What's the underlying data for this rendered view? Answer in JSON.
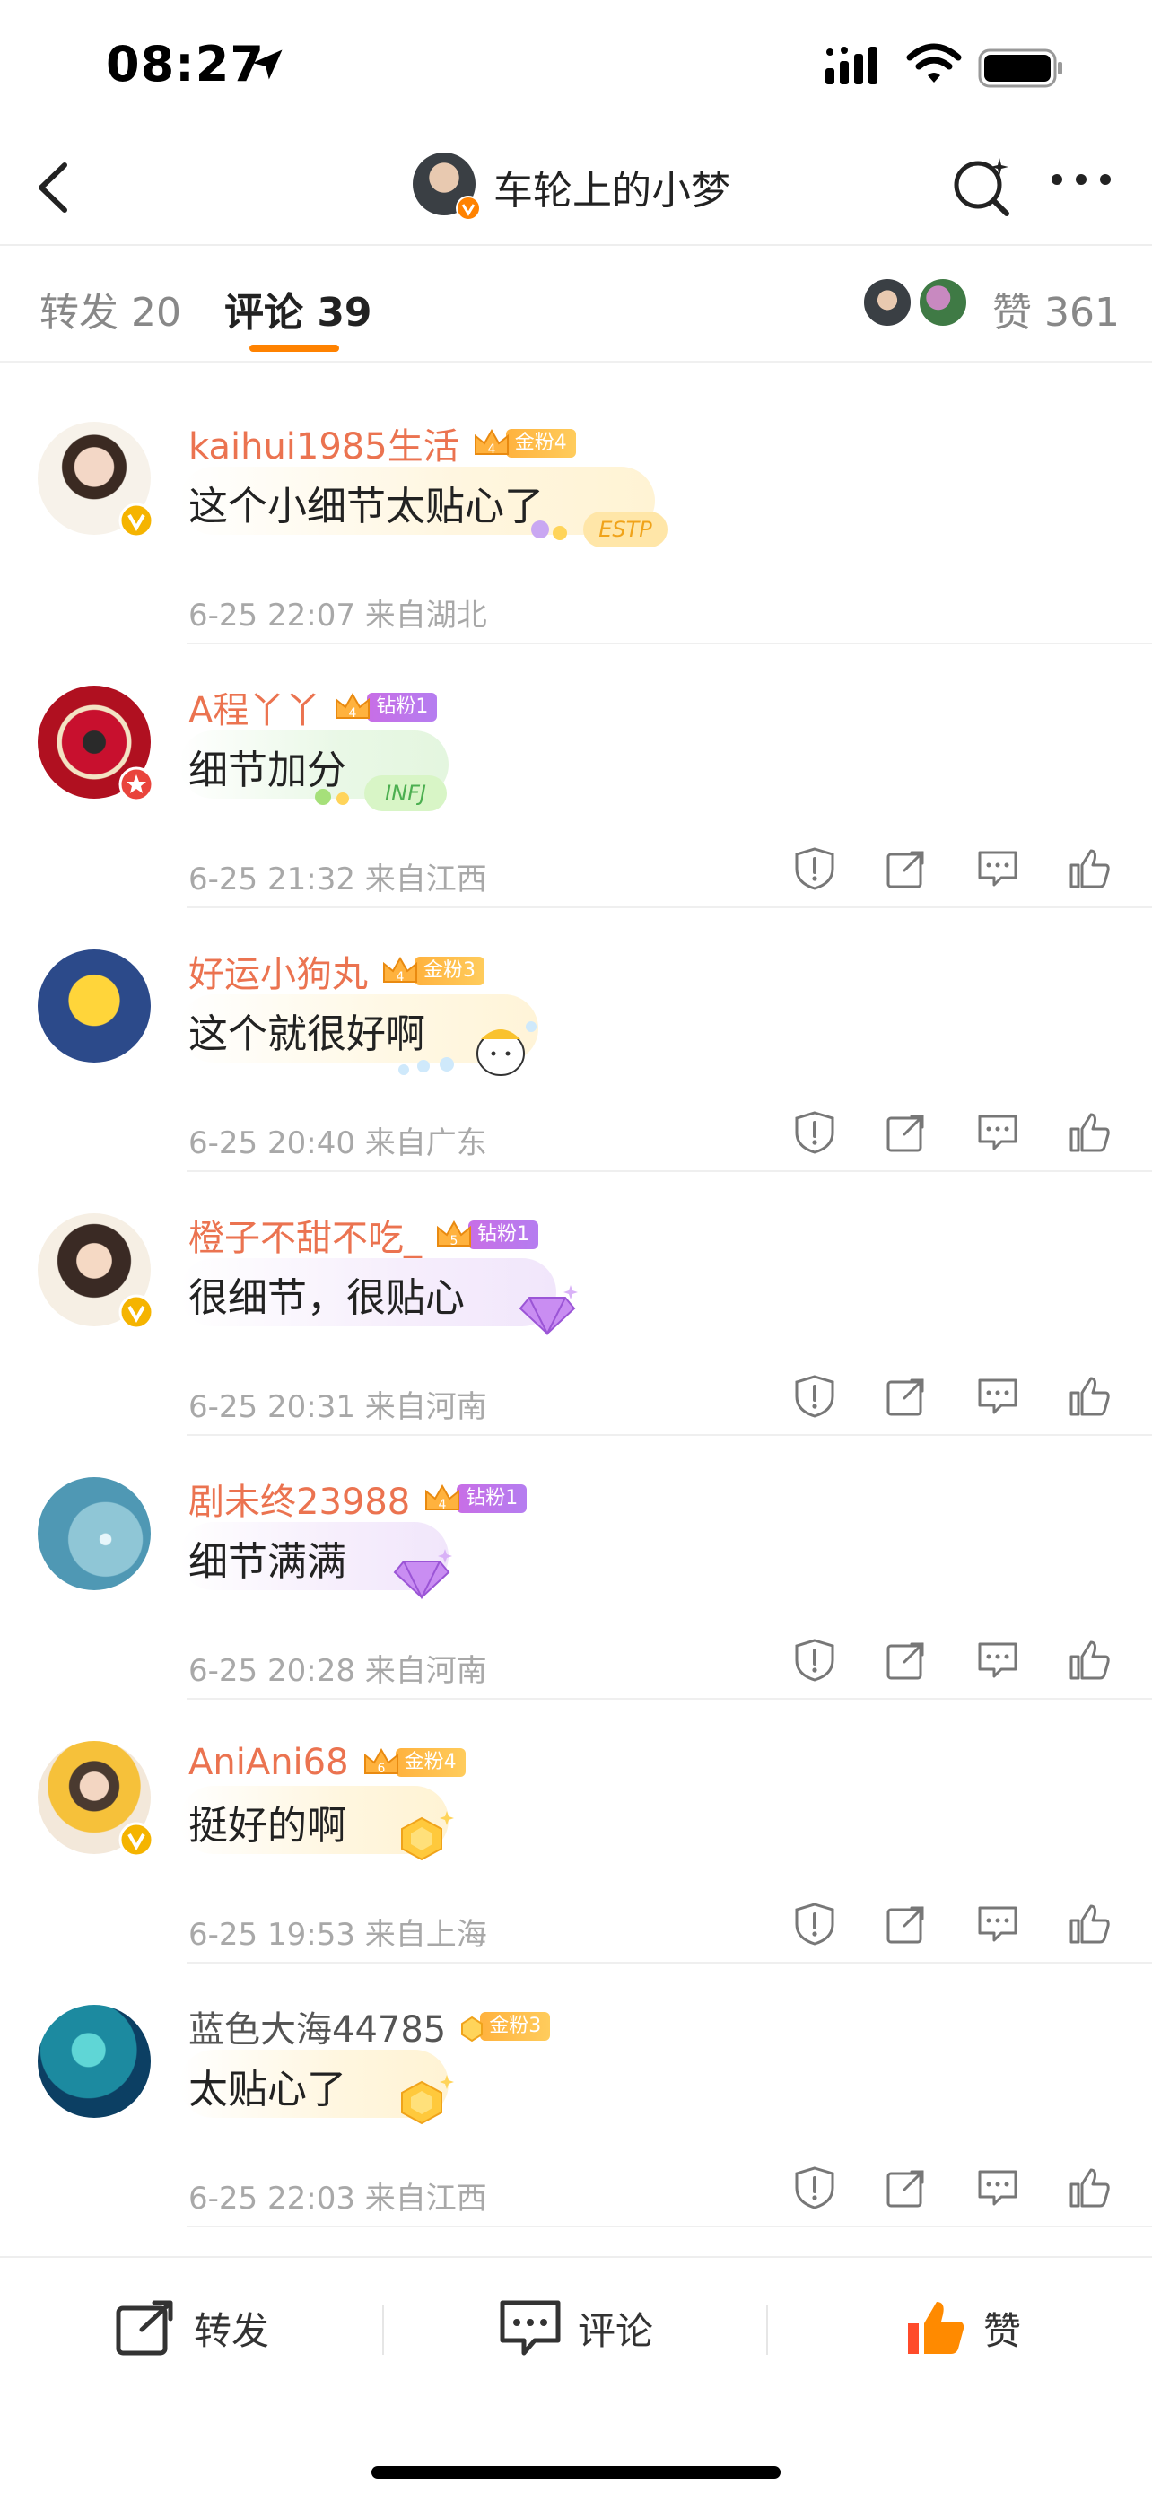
{
  "status": {
    "time": "08:27"
  },
  "nav": {
    "title": "车轮上的小梦"
  },
  "tabs": {
    "repost": "转发 20",
    "comment": "评论 39",
    "like": "赞 361"
  },
  "colors": {
    "accent": "#ff8200",
    "username": "#eb7350",
    "meta": "#a8a8a8",
    "gold_badge": "#ffb23e",
    "diamond_badge": "#c86ee6",
    "verified": "#f5b400",
    "red_badge": "#e9443c",
    "like_active": "#ff6a00"
  },
  "comments": [
    {
      "user": "kaihui1985生活",
      "badge_level": "4",
      "badge_label": "金粉4",
      "badge_type": "gold",
      "text": "这个小细节太贴心了",
      "meta": "6-25 22:07 来自湖北",
      "sticker": "ESTP",
      "avatar_badge": "verified-icon"
    },
    {
      "user": "A程丫丫",
      "badge_level": "4",
      "badge_label": "钻粉1",
      "badge_type": "diamond",
      "text": "细节加分",
      "meta": "6-25 21:32 来自江西",
      "sticker": "INFJ",
      "avatar_badge": "red-verified-icon"
    },
    {
      "user": "好运小狗丸",
      "badge_level": "4",
      "badge_label": "金粉3",
      "badge_type": "gold",
      "text": "这个就很好啊",
      "meta": "6-25 20:40 来自广东",
      "sticker": "cartoon"
    },
    {
      "user": "橙子不甜不吃_",
      "badge_level": "5",
      "badge_label": "钻粉1",
      "badge_type": "diamond",
      "text": "很细节，很贴心",
      "meta": "6-25 20:31 来自河南",
      "sticker": "diamond",
      "avatar_badge": "verified-icon"
    },
    {
      "user": "剧未终23988",
      "badge_level": "4",
      "badge_label": "钻粉1",
      "badge_type": "diamond",
      "text": "细节满满",
      "meta": "6-25 20:28 来自河南",
      "sticker": "diamond"
    },
    {
      "user": "AniAni68",
      "badge_level": "6",
      "badge_label": "金粉4",
      "badge_type": "gold",
      "text": "挺好的啊",
      "meta": "6-25 19:53 来自上海",
      "sticker": "gold",
      "avatar_badge": "verified-icon"
    },
    {
      "user": "蓝色大海44785",
      "badge_level": "",
      "badge_label": "金粉3",
      "badge_type": "gold",
      "text": "太贴心了",
      "meta": "6-25 22:03 来自江西",
      "sticker": "gold"
    }
  ],
  "bottom_bar": {
    "repost": "转发",
    "comment": "评论",
    "like": "赞"
  }
}
